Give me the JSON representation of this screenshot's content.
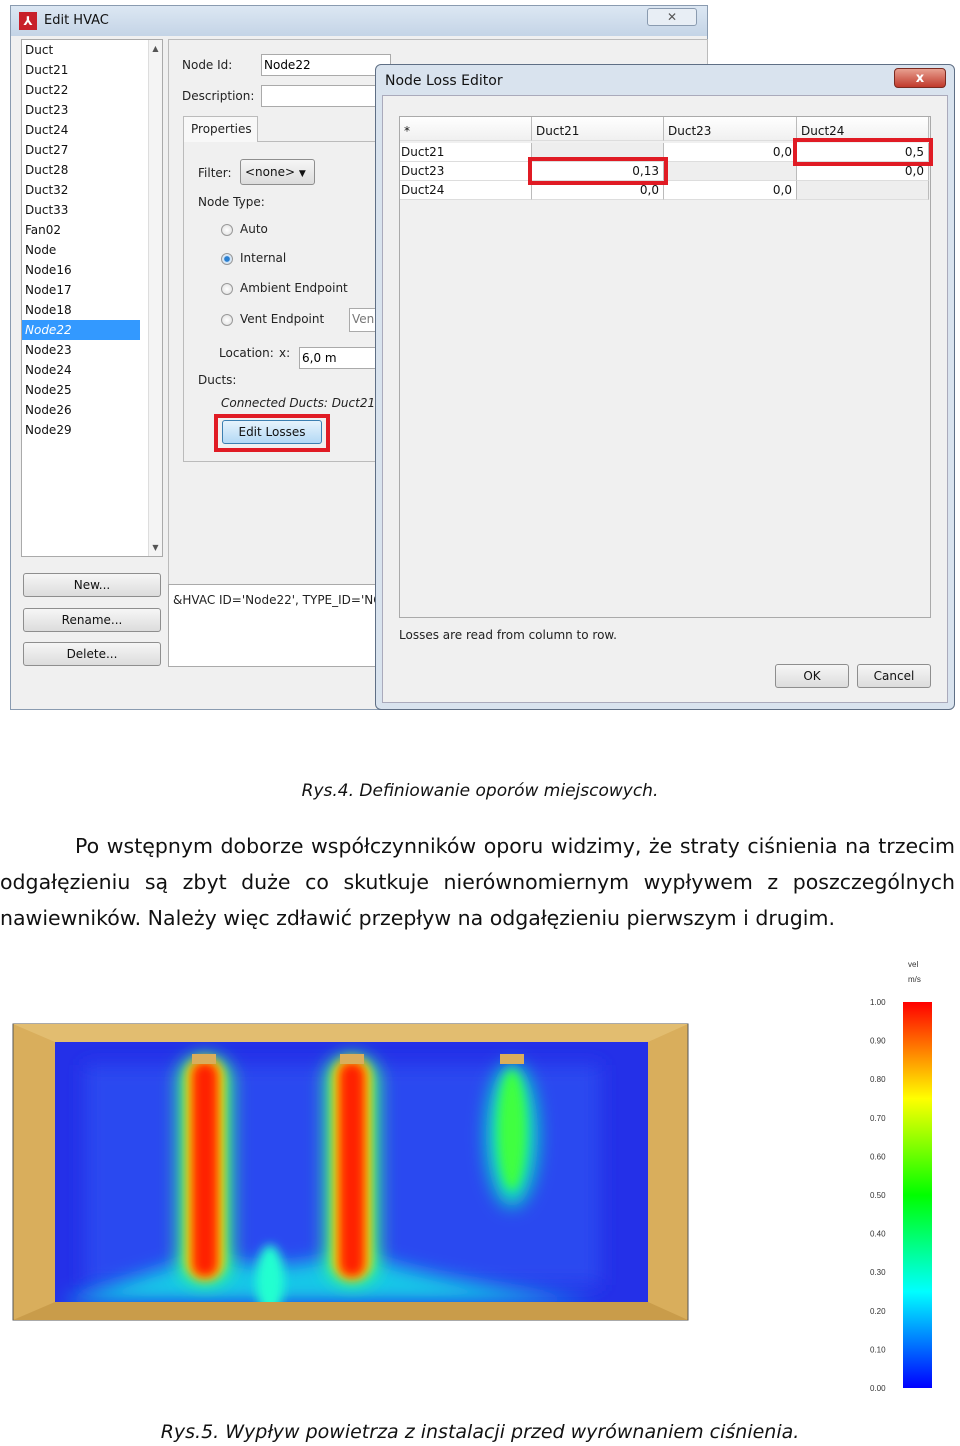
{
  "edit_window": {
    "title": "Edit HVAC",
    "close": "✕",
    "list": [
      "Duct",
      "Duct21",
      "Duct22",
      "Duct23",
      "Duct24",
      "Duct27",
      "Duct28",
      "Duct32",
      "Duct33",
      "Fan02",
      "Node",
      "Node16",
      "Node17",
      "Node18",
      "Node22",
      "Node23",
      "Node24",
      "Node25",
      "Node26",
      "Node29"
    ],
    "selected": "Node22",
    "buttons": {
      "new": "New...",
      "rename": "Rename...",
      "delete": "Delete..."
    },
    "node_id_label": "Node Id:",
    "node_id_value": "Node22",
    "description_label": "Description:",
    "description_value": "",
    "tab": "Properties",
    "filter_label": "Filter:",
    "filter_value": "<none>",
    "node_type_label": "Node Type:",
    "node_types": [
      "Auto",
      "Internal",
      "Ambient Endpoint",
      "Vent Endpoint"
    ],
    "node_type_selected": "Internal",
    "vent_field": "Ven",
    "location_label": "Location:",
    "location_x_label": "x:",
    "location_x_value": "6,0 m",
    "ducts_label": "Ducts:",
    "connected_ducts": "Connected Ducts: Duct21,",
    "edit_losses": "Edit Losses",
    "namelist": "&HVAC ID='Node22', TYPE_ID='NO"
  },
  "loss_editor": {
    "title": "Node Loss Editor",
    "close": "x",
    "corner": "*",
    "columns": [
      "Duct21",
      "Duct23",
      "Duct24"
    ],
    "rows": [
      {
        "name": "Duct21",
        "values": [
          "",
          "0,0",
          "0,5"
        ]
      },
      {
        "name": "Duct23",
        "values": [
          "0,13",
          "",
          "0,0"
        ]
      },
      {
        "name": "Duct24",
        "values": [
          "0,0",
          "0,0",
          ""
        ]
      }
    ],
    "note": "Losses are read from column to row.",
    "ok": "OK",
    "cancel": "Cancel",
    "highlight_color": "#e01b24"
  },
  "caption1": "Rys.4. Definiowanie oporów miejscowych.",
  "paragraph": "Po wstępnym doborze współczynników oporu widzimy, że straty ciśnienia na trzecim odgałęzieniu są zbyt duże co skutkuje nierównomiernym wypływem z poszczególnych nawiewników. Należy więc zdławić przepływ na odgałęzieniu pierwszym i drugim.",
  "figure": {
    "colorbar": {
      "title": "vel",
      "unit": "m/s",
      "ticks": [
        "1.00",
        "0.90",
        "0.80",
        "0.70",
        "0.60",
        "0.50",
        "0.40",
        "0.30",
        "0.20",
        "0.10",
        "0.00"
      ],
      "range": [
        0,
        1
      ],
      "colors": [
        "#ff0000",
        "#ff8000",
        "#ffff00",
        "#80ff00",
        "#00ff00",
        "#00ff80",
        "#00ffff",
        "#0080ff",
        "#0000ff"
      ]
    }
  },
  "caption2": "Rys.5. Wypływ powietrza z instalacji przed wyrównaniem ciśnienia."
}
